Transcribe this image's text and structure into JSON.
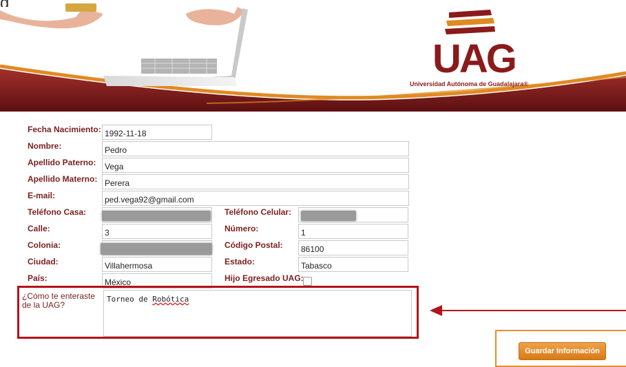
{
  "brand": {
    "logo": "UAG",
    "name": "Universidad Autónoma de Guadalajara®",
    "maroon": "#8b1a1a",
    "orange": "#e08a22"
  },
  "top_partial_text": "g",
  "form": {
    "fecha_nacimiento": {
      "label": "Fecha Nacimiento:",
      "value": "1992-11-18"
    },
    "nombre": {
      "label": "Nombre:",
      "value": "Pedro"
    },
    "apellido_paterno": {
      "label": "Apellido Paterno:",
      "value": "Vega"
    },
    "apellido_materno": {
      "label": "Apellido Materno:",
      "value": "Perera"
    },
    "email": {
      "label": "E-mail:",
      "value": "ped.vega92@gmail.com"
    },
    "telefono_casa": {
      "label": "Teléfono Casa:",
      "value": ""
    },
    "telefono_celular": {
      "label": "Teléfono Celular:",
      "value": ""
    },
    "calle": {
      "label": "Calle:",
      "value": "3"
    },
    "numero": {
      "label": "Número:",
      "value": "1"
    },
    "colonia": {
      "label": "Colonia:",
      "value": ""
    },
    "codigo_postal": {
      "label": "Código Postal:",
      "value": "86100"
    },
    "ciudad": {
      "label": "Ciudad:",
      "value": "Villahermosa"
    },
    "estado": {
      "label": "Estado:",
      "value": "Tabasco"
    },
    "pais": {
      "label": "País:",
      "value": "México"
    },
    "hijo_egresado": {
      "label": "Hijo Egresado UAG:",
      "checked": false
    },
    "como_te_enteraste": {
      "label_line1": "¿Cómo te enteraste",
      "label_line2": "de la UAG?",
      "value_plain": "Torneo de ",
      "value_misspelled": "Robótica"
    }
  },
  "buttons": {
    "save": "Guardar Información"
  },
  "annotation_color": "#b3121a"
}
